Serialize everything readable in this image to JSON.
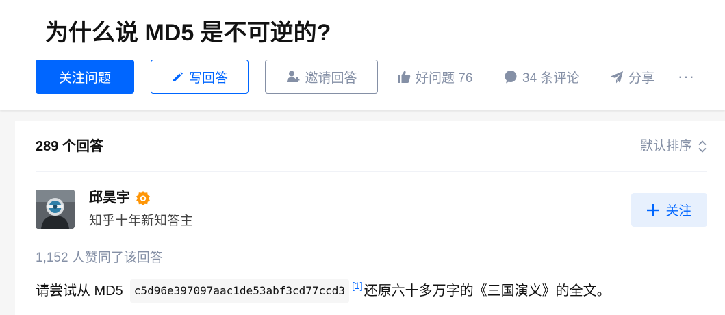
{
  "question": {
    "title": "为什么说 MD5 是不可逆的?"
  },
  "actions": {
    "follow_question": "关注问题",
    "write_answer": "写回答",
    "invite": "邀请回答",
    "good_question": "好问题 76",
    "comments": "34 条评论",
    "share": "分享",
    "more": "···"
  },
  "answers": {
    "count_label": "289 个回答",
    "sort_label": "默认排序"
  },
  "answer": {
    "author": {
      "name": "邱昊宇",
      "bio": "知乎十年新知答主",
      "follow_label": "关注"
    },
    "vote_text": "1,152 人赞同了该回答",
    "content_prefix": "请尝试从 MD5",
    "hash": "c5d96e397097aac1de53abf3cd77ccd3",
    "ref": "[1]",
    "content_suffix": "还原六十多万字的《三国演义》的全文。"
  },
  "colors": {
    "primary": "#0066ff",
    "muted": "#8590a6",
    "badge": "#ff9607"
  },
  "icons": [
    "pencil-icon",
    "add-user-icon",
    "thumb-up-icon",
    "comment-icon",
    "share-icon",
    "more-icon",
    "sort-icon",
    "badge-icon",
    "plus-icon"
  ]
}
